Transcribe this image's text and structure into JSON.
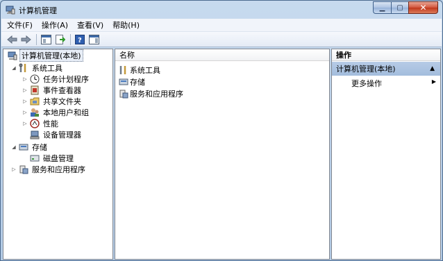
{
  "window": {
    "title": "计算机管理"
  },
  "menu": [
    "文件(F)",
    "操作(A)",
    "查看(V)",
    "帮助(H)"
  ],
  "tree": {
    "root": "计算机管理(本地)",
    "system_tools": "系统工具",
    "task_scheduler": "任务计划程序",
    "event_viewer": "事件查看器",
    "shared_folders": "共享文件夹",
    "local_users": "本地用户和组",
    "performance": "性能",
    "device_manager": "设备管理器",
    "storage": "存储",
    "disk_management": "磁盘管理",
    "services_apps": "服务和应用程序"
  },
  "list": {
    "column_name": "名称",
    "items": [
      "系统工具",
      "存储",
      "服务和应用程序"
    ]
  },
  "actions": {
    "header": "操作",
    "section": "计算机管理(本地)",
    "more": "更多操作"
  }
}
